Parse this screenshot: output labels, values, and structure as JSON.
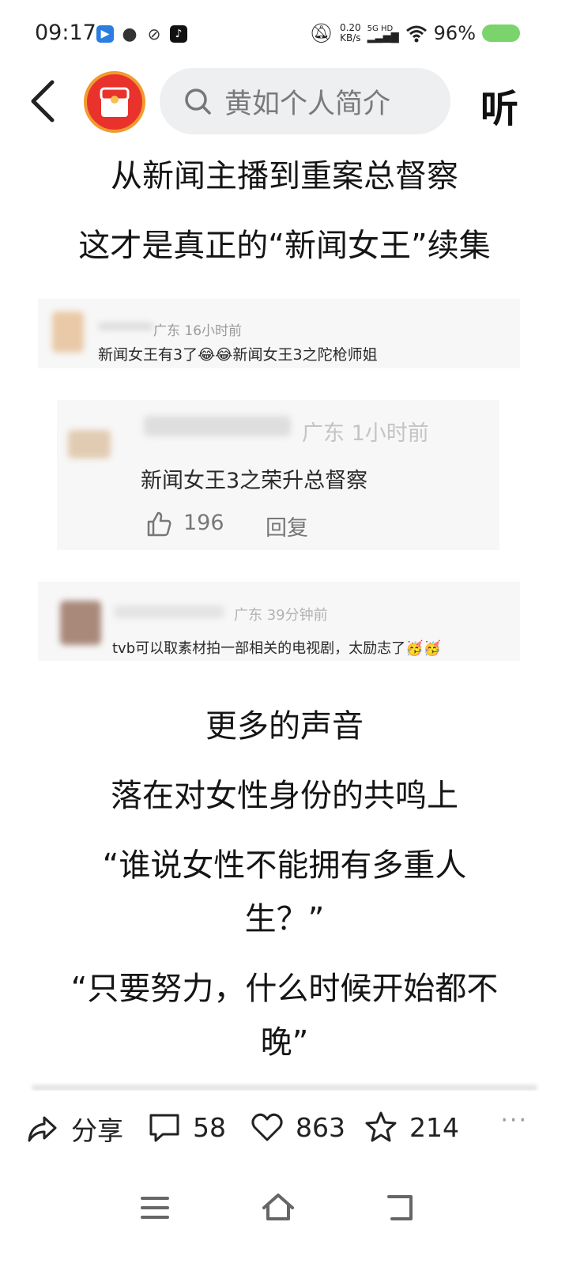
{
  "status_bar": {
    "time": "09:17",
    "net_speed_value": "0.20",
    "net_speed_unit": "KB/s",
    "signal_label": "5G HD",
    "battery_percent": "96%"
  },
  "header": {
    "search_placeholder": "黄如个人简介",
    "listen_label": "听"
  },
  "article": {
    "top_lines": [
      "从新闻主播到重案总督察",
      "这才是真正的“新闻女王”续集"
    ],
    "bottom_lines": [
      "更多的声音",
      "落在对女性身份的共鸣上",
      "“谁说女性不能拥有多重人",
      "生？”",
      "“只要努力，什么时候开始都不",
      "晚”"
    ]
  },
  "comments": [
    {
      "location_time": "广东 16小时前",
      "text": "新闻女王有3了😂😂新闻女王3之陀枪师姐"
    },
    {
      "location_time": "广东 1小时前",
      "text": "新闻女王3之荣升总督察",
      "likes": "196",
      "reply_label": "回复"
    },
    {
      "location_time": "广东 39分钟前",
      "text": "tvb可以取素材拍一部相关的电视剧，太励志了🥳🥳"
    }
  ],
  "actions": {
    "share_label": "分享",
    "comments_count": "58",
    "likes_count": "863",
    "favorites_count": "214",
    "more_label": "···"
  },
  "colors": {
    "accent_orange": "#f29a2e",
    "avatar_red": "#e8322b",
    "search_bg": "#eeeff1",
    "battery_green": "#7ad36b"
  }
}
